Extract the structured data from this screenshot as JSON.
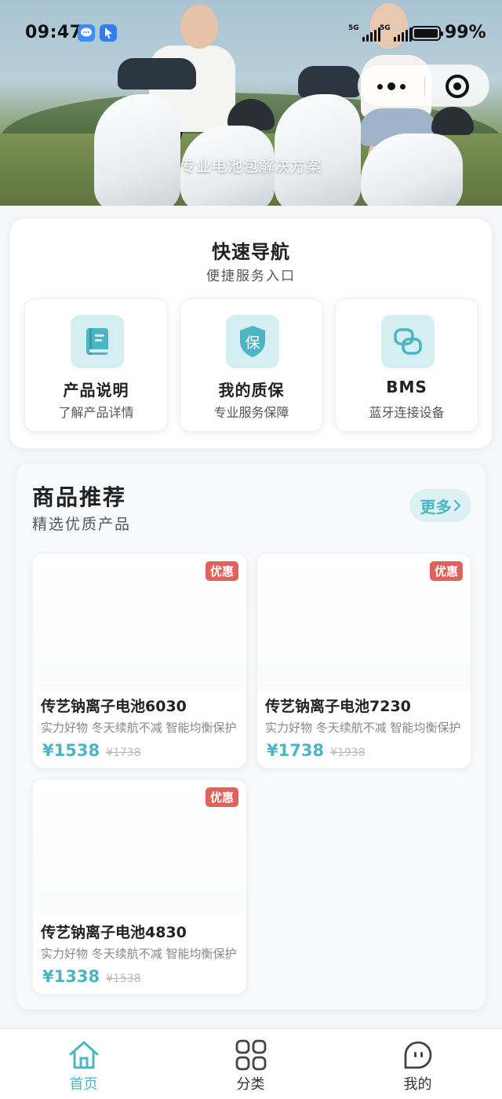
{
  "status_bar": {
    "time": "09:47",
    "network_1": "5G",
    "network_2": "5G",
    "battery": "99%"
  },
  "capsule": {
    "more_icon": "more-dots-icon",
    "close_icon": "target-close-icon"
  },
  "banner": {
    "caption": "专业电池包解决方案"
  },
  "quick_nav": {
    "title": "快速导航",
    "subtitle": "便捷服务入口",
    "items": [
      {
        "title": "产品说明",
        "desc": "了解产品详情",
        "icon": "book-icon"
      },
      {
        "title": "我的质保",
        "desc": "专业服务保障",
        "icon": "shield-icon",
        "icon_text": "保"
      },
      {
        "title": "BMS",
        "desc": "蓝牙连接设备",
        "icon": "link-icon"
      }
    ]
  },
  "products": {
    "title": "商品推荐",
    "subtitle": "精选优质产品",
    "more_label": "更多",
    "items": [
      {
        "badge": "优惠",
        "name": "传艺钠离子电池6030",
        "desc": "实力好物 冬天续航不减 智能均衡保护",
        "price": "¥1538",
        "old_price": "¥1738"
      },
      {
        "badge": "优惠",
        "name": "传艺钠离子电池7230",
        "desc": "实力好物 冬天续航不减 智能均衡保护",
        "price": "¥1738",
        "old_price": "¥1938"
      },
      {
        "badge": "优惠",
        "name": "传艺钠离子电池4830",
        "desc": "实力好物 冬天续航不减 智能均衡保护",
        "price": "¥1338",
        "old_price": "¥1538"
      }
    ]
  },
  "tabbar": {
    "tabs": [
      {
        "label": "首页",
        "icon": "home-icon",
        "active": true
      },
      {
        "label": "分类",
        "icon": "grid-icon",
        "active": false
      },
      {
        "label": "我的",
        "icon": "profile-icon",
        "active": false
      }
    ]
  },
  "colors": {
    "accent": "#4bb6c3",
    "badge": "#e0625b",
    "icon_bg": "#d4eef1"
  }
}
